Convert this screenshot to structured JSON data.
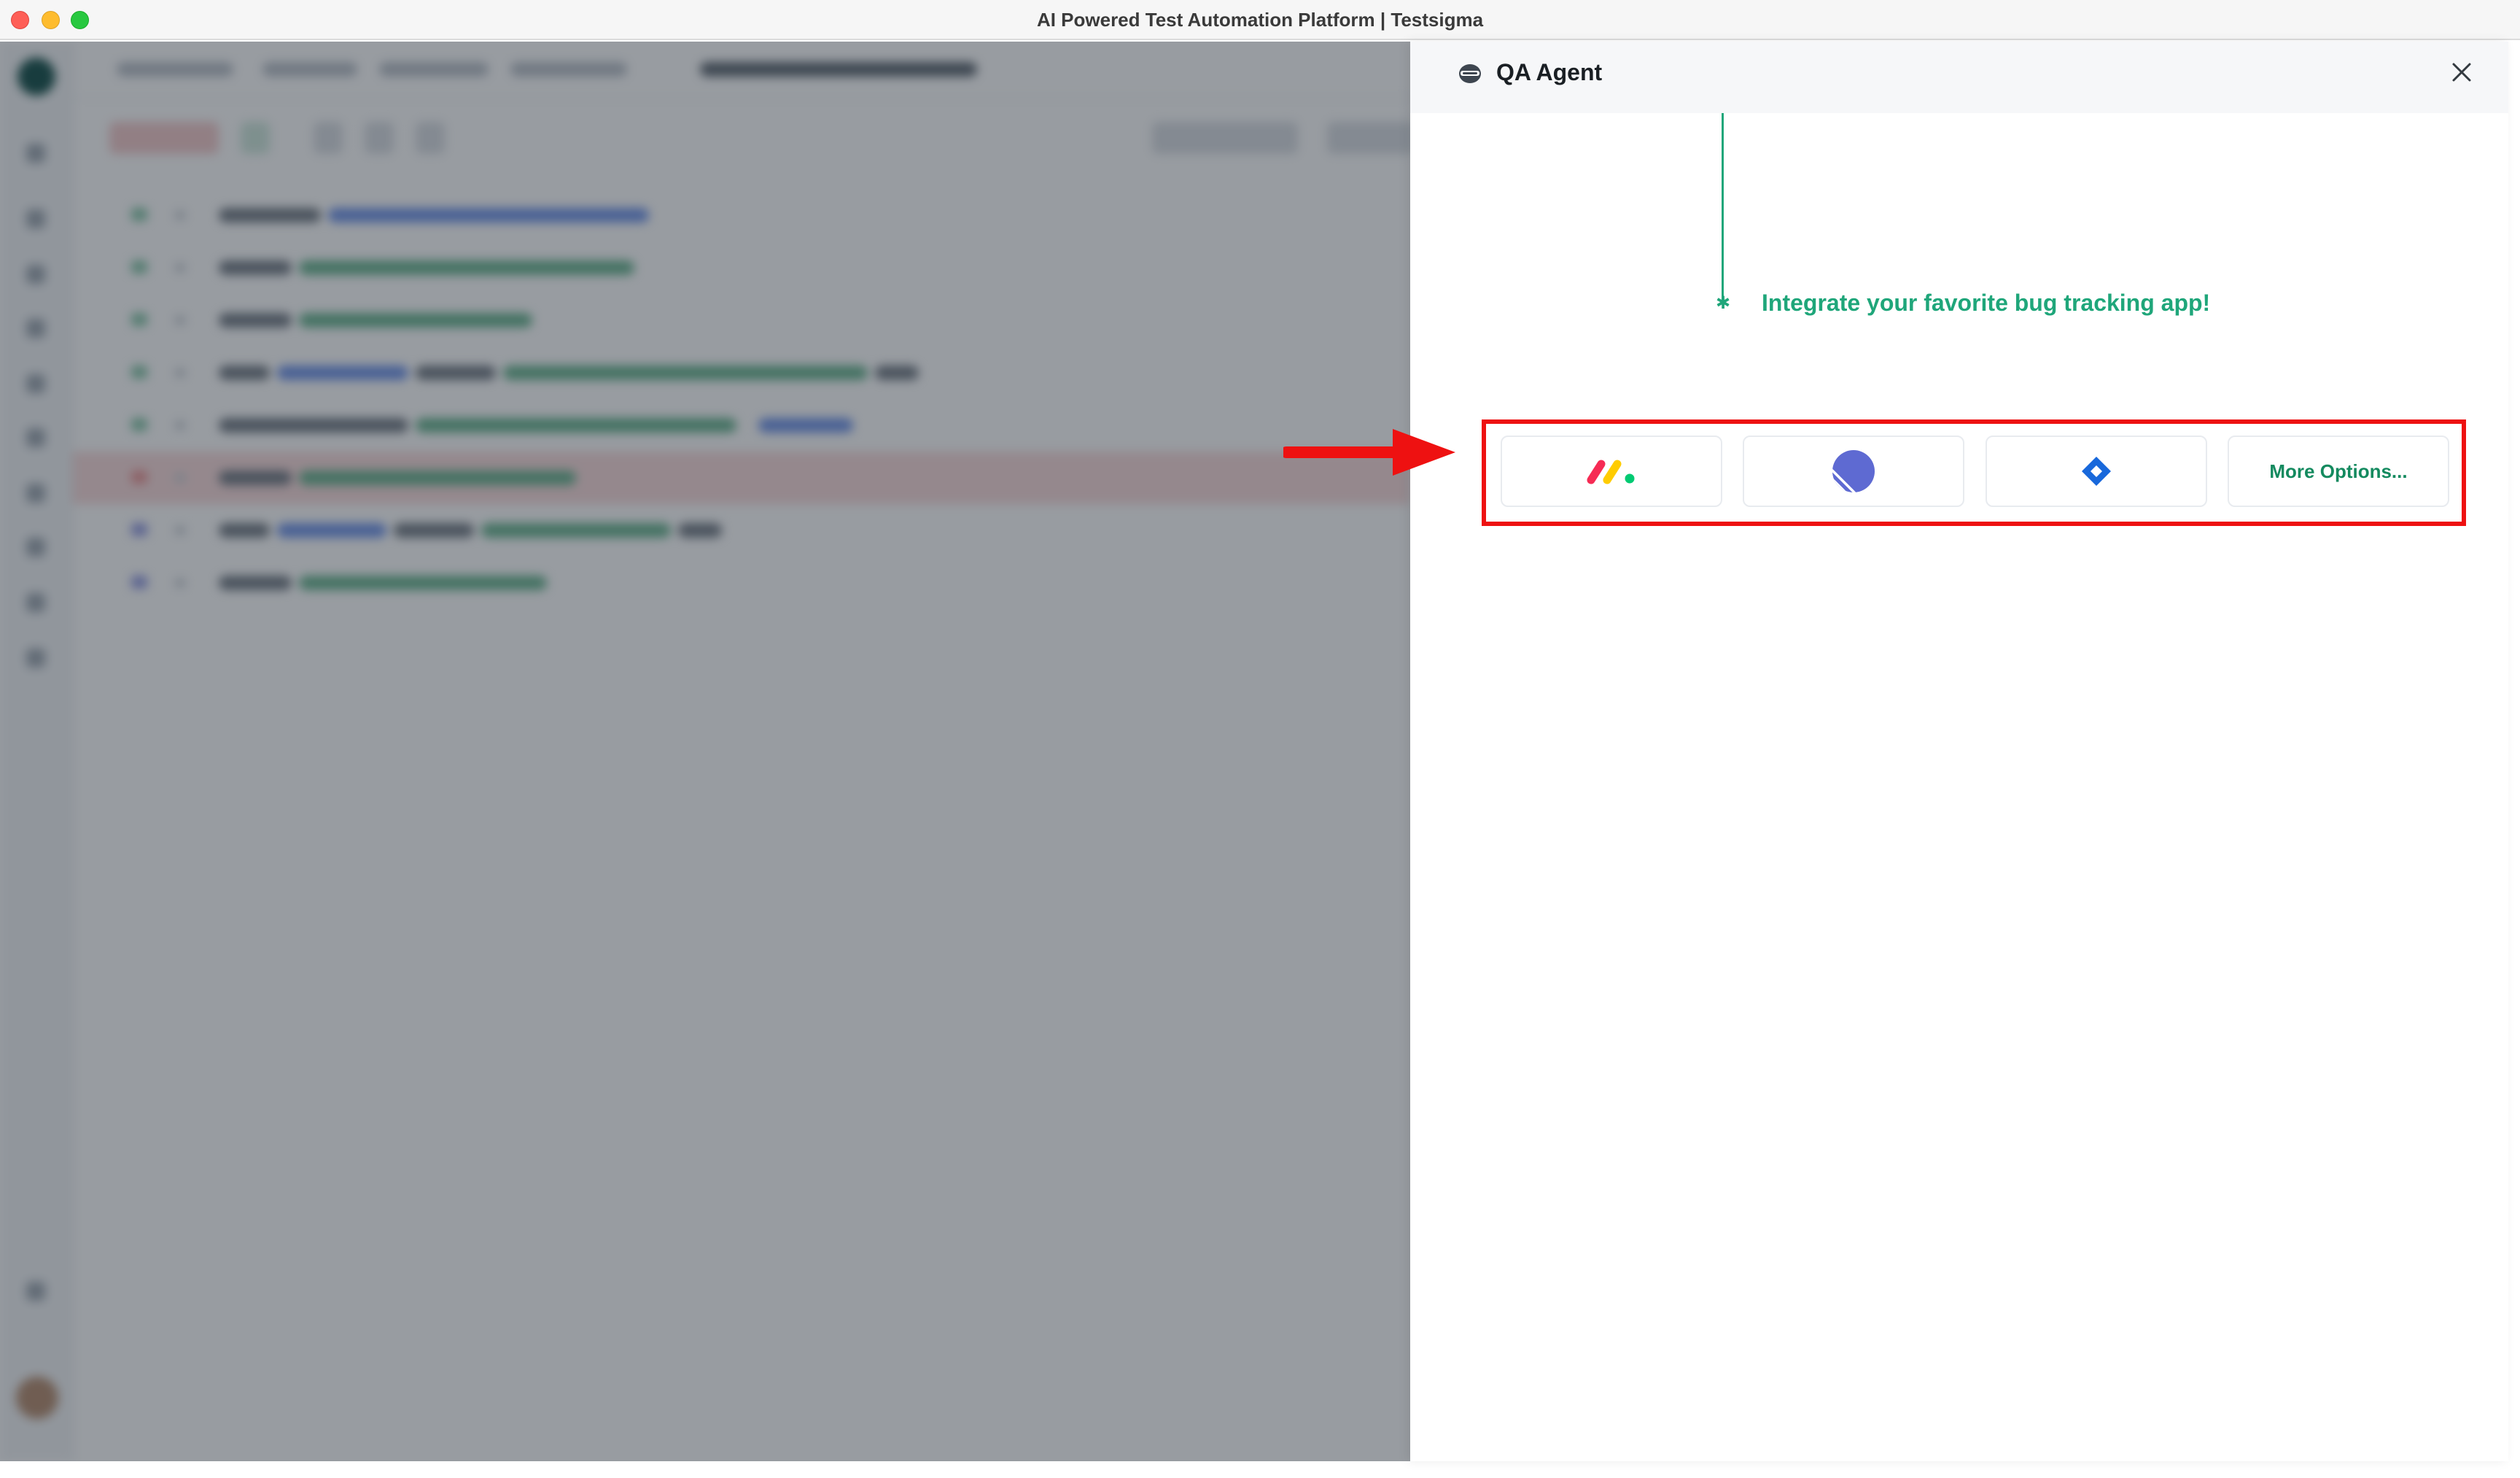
{
  "window": {
    "title": "AI Powered Test Automation Platform | Testsigma"
  },
  "panel": {
    "title": "QA Agent",
    "integrate_text": "Integrate your favorite bug tracking app!",
    "integrations": [
      {
        "name": "monday-logo-icon"
      },
      {
        "name": "linear-logo-icon"
      },
      {
        "name": "jira-logo-icon"
      }
    ],
    "more_options_label": "More Options..."
  },
  "colors": {
    "accent_green": "#1fa67a",
    "highlight_red": "#ee1111",
    "overlay": "rgba(36,44,56,0.47)"
  }
}
